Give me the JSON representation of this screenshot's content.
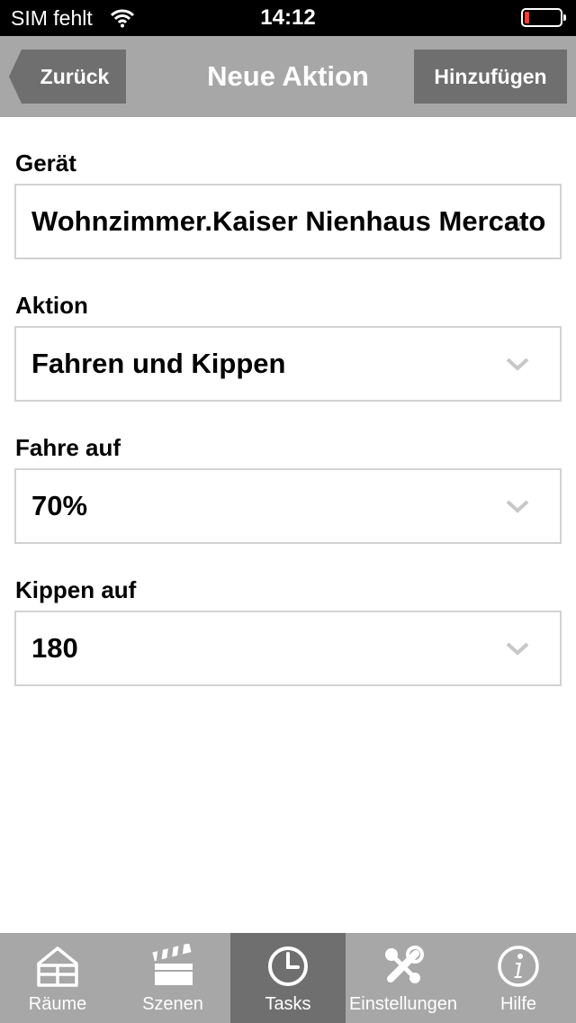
{
  "status_bar": {
    "carrier": "SIM fehlt",
    "time": "14:12",
    "battery_level": 0.05
  },
  "nav": {
    "back_label": "Zurück",
    "title": "Neue Aktion",
    "add_label": "Hinzufügen"
  },
  "form": {
    "device": {
      "label": "Gerät",
      "value": "Wohnzimmer.Kaiser Nienhaus Mercato"
    },
    "action": {
      "label": "Aktion",
      "value": "Fahren und Kippen"
    },
    "drive_to": {
      "label": "Fahre auf",
      "value": "70%"
    },
    "tilt_to": {
      "label": "Kippen auf",
      "value": "180"
    }
  },
  "tabs": [
    {
      "label": "Räume",
      "icon": "house-icon",
      "active": false
    },
    {
      "label": "Szenen",
      "icon": "clapperboard-icon",
      "active": false
    },
    {
      "label": "Tasks",
      "icon": "clock-icon",
      "active": true
    },
    {
      "label": "Einstellungen",
      "icon": "tools-icon",
      "active": false
    },
    {
      "label": "Hilfe",
      "icon": "info-icon",
      "active": false
    }
  ],
  "colors": {
    "bar_gray": "#a7a7a7",
    "button_dark": "#6f6f6f",
    "battery_low": "#ff3b30"
  }
}
